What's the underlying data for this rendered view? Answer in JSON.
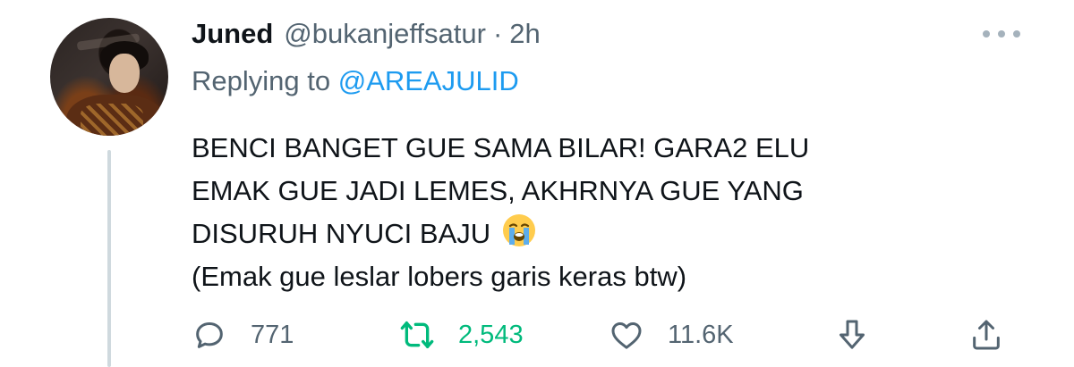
{
  "author": {
    "display_name": "Juned",
    "handle": "@bukanjeffsatur",
    "separator": "·",
    "time": "2h"
  },
  "reply": {
    "prefix": "Replying to",
    "mention": "@AREAJULID"
  },
  "body": {
    "lines": [
      "BENCI BANGET GUE SAMA BILAR! GARA2 ELU",
      "EMAK GUE JADI LEMES, AKHRNYA GUE YANG",
      "DISURUH NYUCI BAJU",
      "(Emak gue leslar lobers garis keras btw)"
    ],
    "emoji": "loudly-crying-face"
  },
  "actions": {
    "replies": "771",
    "retweets": "2,543",
    "likes": "11.6K"
  },
  "icons": {
    "more": "more-horizontal-icon",
    "reply": "reply-icon",
    "retweet": "retweet-icon",
    "like": "heart-icon",
    "downvote": "downvote-arrow-icon",
    "share": "share-icon"
  },
  "colors": {
    "text": "#0f1419",
    "secondary": "#536471",
    "link": "#1d9bf0",
    "retweet_active": "#00ba7c",
    "thread_line": "#cfd9de"
  }
}
